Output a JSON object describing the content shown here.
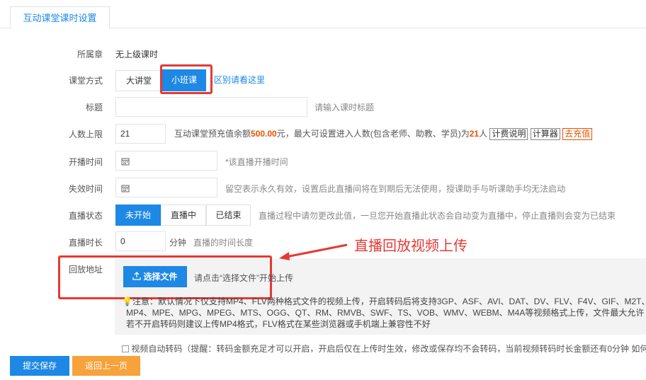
{
  "tab": {
    "label": "互动课堂课时设置"
  },
  "chapter": {
    "label": "所属章",
    "value": "无上级课时"
  },
  "mode": {
    "label": "课堂方式",
    "options": [
      "大讲堂",
      "小班课"
    ],
    "selected": "小班课",
    "link": "区别请看这里"
  },
  "title_field": {
    "label": "标题",
    "value": "",
    "hint": "请输入课时标题"
  },
  "capacity": {
    "label": "人数上限",
    "value": "21",
    "hint_prefix": "互动课堂预充值余额",
    "balance": "500.00",
    "hint_mid": "元，最大可设置进入人数(包含老师、助教、学员)为",
    "max": "21",
    "hint_suffix": "人",
    "fee_btn": "计费说明",
    "calc_btn": "计算器",
    "recharge_btn": "去充值"
  },
  "start_time": {
    "label": "开播时间",
    "hint": "*该直播开播时间"
  },
  "expire_time": {
    "label": "失效时间",
    "hint": "留空表示永久有效，设置后此直播间将在到期后无法使用，授课助手与听课助手均无法启动"
  },
  "status": {
    "label": "直播状态",
    "options": [
      "未开始",
      "直播中",
      "已结束"
    ],
    "selected": "未开始",
    "hint": "直播过程中请勿更改此值，一旦您开始直播此状态会自动变为直播中，停止直播则会变为已结束"
  },
  "duration": {
    "label": "直播时长",
    "value": "0",
    "unit": "分钟",
    "hint": "直播的时间长度"
  },
  "playback": {
    "label": "回放地址",
    "choose_btn": "选择文件",
    "choose_hint": "请点击“选择文件”开始上传",
    "note_line1": "注意：默认情况下仅支持MP4、FLV两种格式文件的视频上传，开启转码后将支持3GP、ASF、AVI、DAT、DV、FLV、F4V、GIF、M2T、",
    "note_line2": "MP4、MPE、MPG、MPEG、MTS、OGG、QT、RM、RMVB、SWF、TS、VOB、WMV、WEBM、M4A等视频格式上传，文件最大允许",
    "note_line3": "若不开启转码则建议上传MP4格式，FLV格式在某些浏览器或手机端上兼容性不好",
    "auto_transcode": "视频自动转码（提醒：转码金额充足才可以开启，开启后仅在上传时生效，修改或保存均不会转码，当前视频转码时长金额还有0分钟 如何"
  },
  "annotation": {
    "text": "直播回放视频上传"
  },
  "footer": {
    "submit": "提交保存",
    "back": "返回上一页"
  },
  "colors": {
    "primary": "#1e88e5",
    "orange": "#f7a23a",
    "red": "#e53935",
    "highlight": "#e65100"
  }
}
